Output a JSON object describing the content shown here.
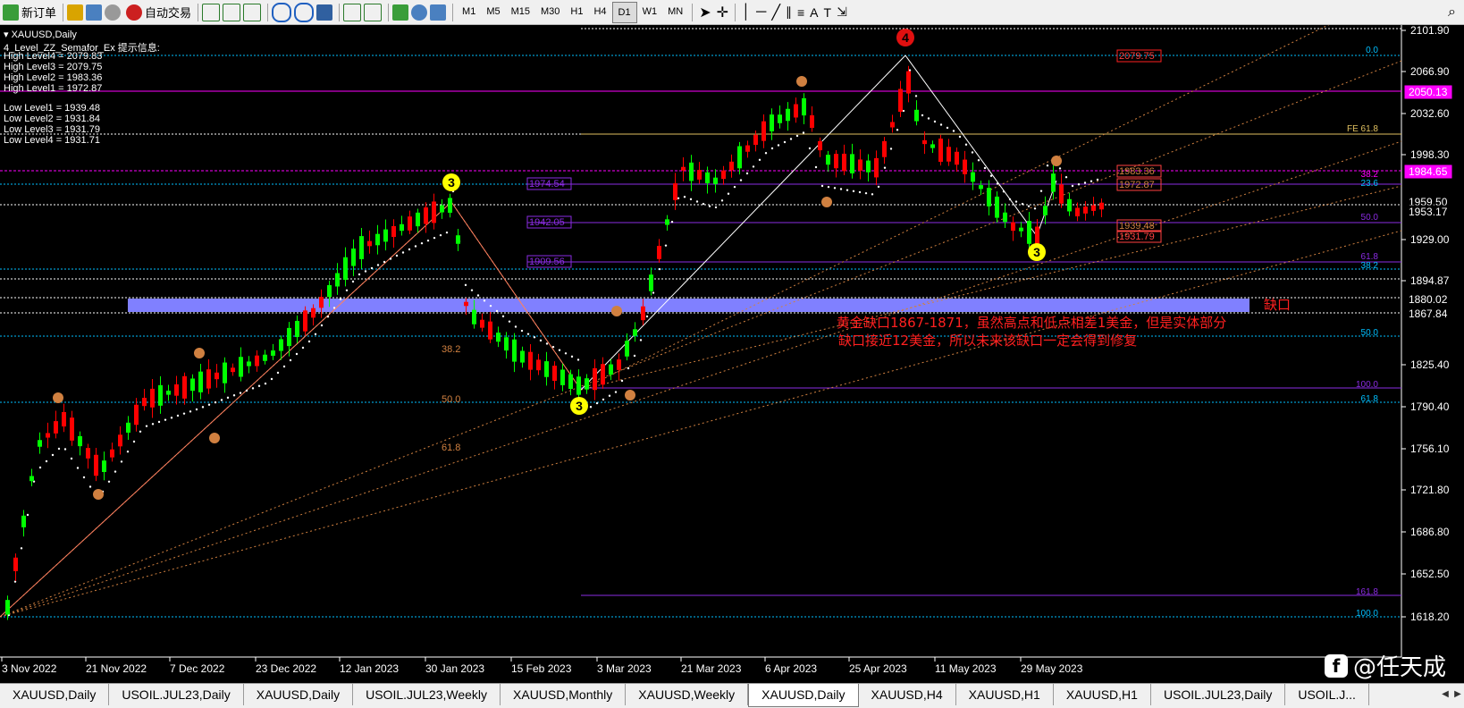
{
  "toolbar": {
    "new_order_label": "新订单",
    "autotrade_label": "自动交易",
    "timeframes": [
      "M1",
      "M5",
      "M15",
      "M30",
      "H1",
      "H4",
      "D1",
      "W1",
      "MN"
    ],
    "active_timeframe": "D1"
  },
  "chart": {
    "symbol_title": "XAUUSD,Daily",
    "indicator_title": "4_Level_ZZ_Semafor_Ex 提示信息:",
    "high_levels": [
      "High Level4 = 2079.83",
      "High Level3 = 2079.75",
      "High Level2 = 1983.36",
      "High Level1 = 1972.87"
    ],
    "low_levels": [
      "Low Level1 = 1939.48",
      "Low Level2 = 1931.84",
      "Low Level3 = 1931.79",
      "Low Level4 = 1931.71"
    ],
    "price_ticks": [
      "2101.90",
      "2066.90",
      "2032.60",
      "1998.30",
      "1929.00",
      "1894.87",
      "1825.40",
      "1790.40",
      "1756.10",
      "1721.80",
      "1686.80",
      "1652.50",
      "1618.20"
    ],
    "right_axis_boxes": [
      {
        "label": "2050.13",
        "color": "#ff00ff"
      },
      {
        "label": "1984.65",
        "color": "#ff00ff"
      },
      {
        "label": "1959.50",
        "color": "#ffffff"
      },
      {
        "label": "1953.17",
        "color": "#ffffff"
      },
      {
        "label": "1880.02",
        "color": "#ffffff"
      },
      {
        "label": "1867.84",
        "color": "#ffffff"
      }
    ],
    "date_labels": [
      "3 Nov 2022",
      "21 Nov 2022",
      "7 Dec 2022",
      "23 Dec 2022",
      "12 Jan 2023",
      "30 Jan 2023",
      "15 Feb 2023",
      "3 Mar 2023",
      "21 Mar 2023",
      "6 Apr 2023",
      "25 Apr 2023",
      "11 May 2023",
      "29 May 2023"
    ],
    "fib_labels_left": [
      "1974.54",
      "1942.05",
      "1909.56"
    ],
    "fib_labels_right": [
      "0.0",
      "FE 61.8",
      "38.2",
      "23.6",
      "50.0",
      "61.8",
      "38.2",
      "50.0",
      "100.0",
      "61.8",
      "161.8",
      "100.0"
    ],
    "fan_labels": [
      "38.2",
      "50.0",
      "61.8"
    ],
    "semafor_price_boxes": [
      "2079.75",
      "1983.36",
      "1972.87",
      "1939.48",
      "1931.79"
    ],
    "gap_label": "缺口",
    "annotation_line1": "黄金缺口1867-1871，虽然高点和低点相差1美金，但是实体部分",
    "annotation_line2": "缺口接近12美金，所以未来该缺口一定会得到修复",
    "wave_labels": [
      "4",
      "3",
      "3",
      "3"
    ],
    "colors": {
      "bull": "#00ff00",
      "bear": "#ff0000",
      "gap_zone": "#8080ff",
      "fib_purple": "#8a2be2",
      "annotation": "#ff0000"
    }
  },
  "tabs": [
    "XAUUSD,Daily",
    "USOIL.JUL23,Daily",
    "XAUUSD,Daily",
    "USOIL.JUL23,Weekly",
    "XAUUSD,Monthly",
    "XAUUSD,Weekly",
    "XAUUSD,Daily",
    "XAUUSD,H4",
    "XAUUSD,H1",
    "XAUUSD,H1",
    "USOIL.JUL23,Daily",
    "USOIL.J..."
  ],
  "active_tab_index": 6,
  "watermark": {
    "logo": "f",
    "text": "@任天成"
  }
}
